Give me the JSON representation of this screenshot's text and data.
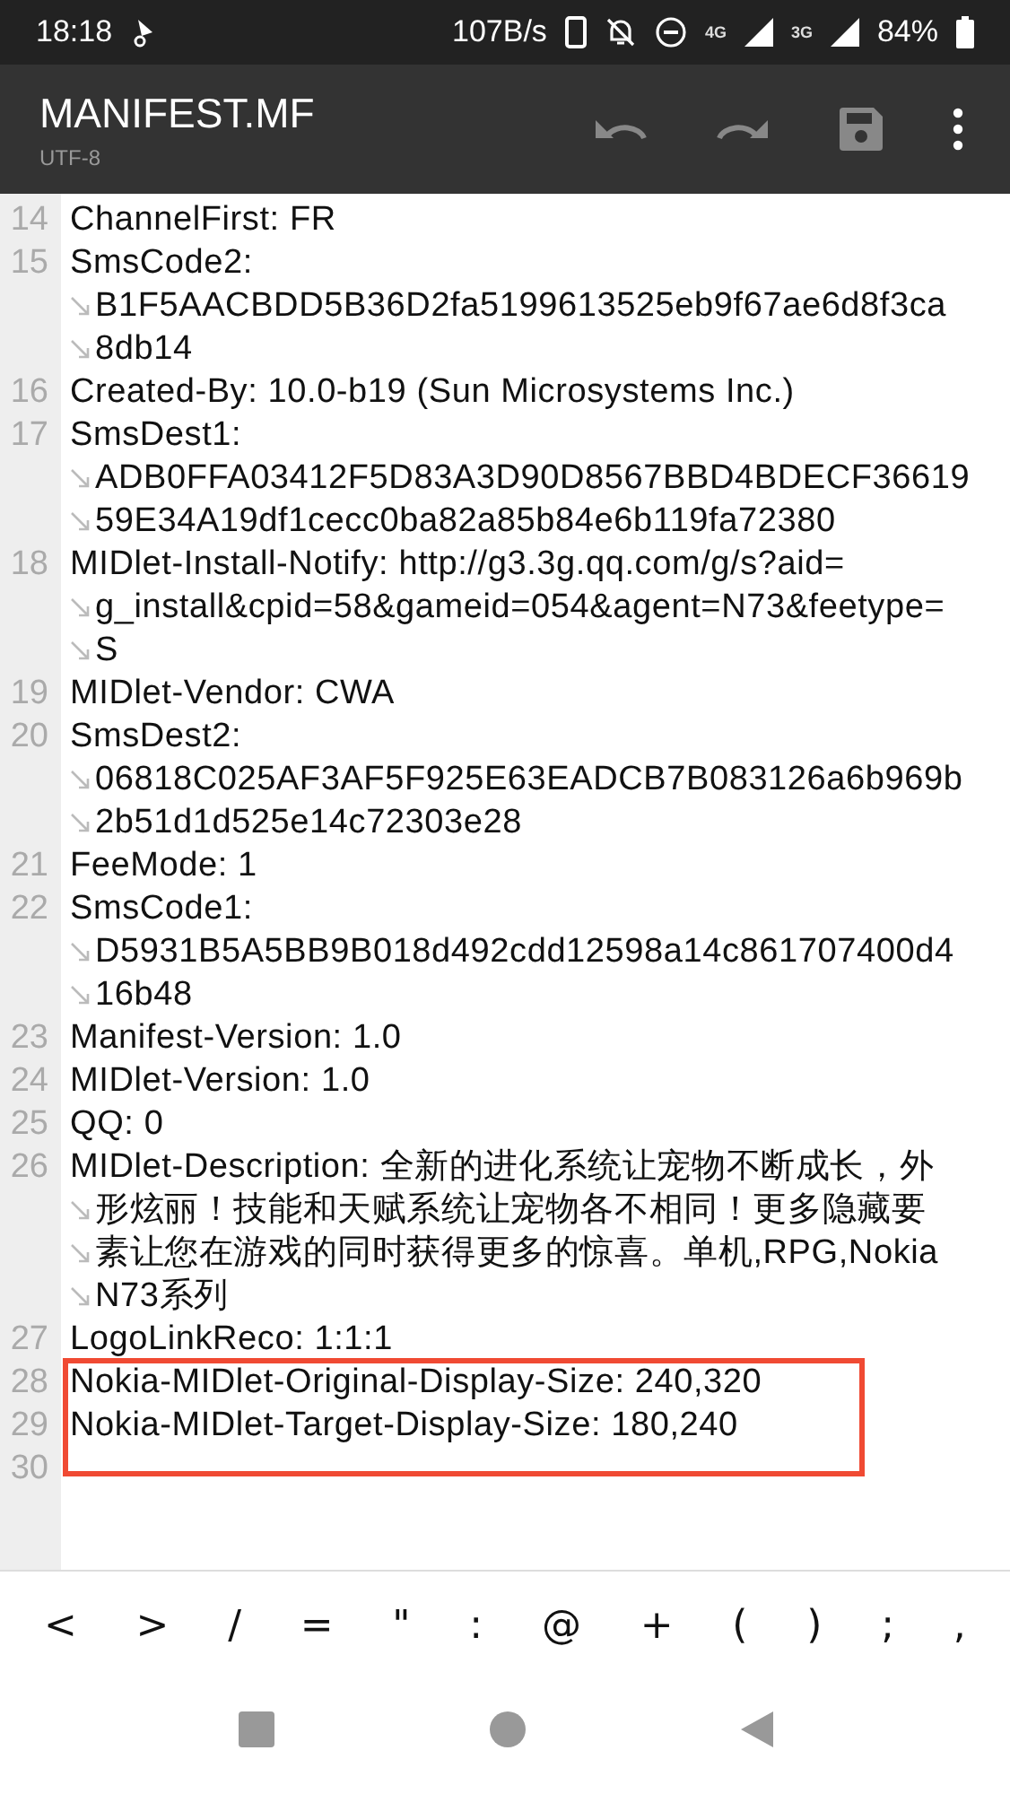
{
  "status_bar": {
    "time": "18:18",
    "speed": "107B/s",
    "network_4g": "4G",
    "network_3g": "3G",
    "battery": "84%"
  },
  "toolbar": {
    "title": "MANIFEST.MF",
    "encoding": "UTF-8"
  },
  "editor": {
    "lines": [
      {
        "number": "14",
        "rows": [
          "ChannelFirst: FR"
        ],
        "highlighted": false
      },
      {
        "number": "15",
        "rows": [
          "SmsCode2:",
          "B1F5AACBDD5B36D2fa5199613525eb9f67ae6d8f3ca",
          "8db14"
        ],
        "highlighted": false
      },
      {
        "number": "16",
        "rows": [
          "Created-By: 10.0-b19 (Sun Microsystems Inc.)"
        ],
        "highlighted": false
      },
      {
        "number": "17",
        "rows": [
          "SmsDest1:",
          "ADB0FFA03412F5D83A3D90D8567BBD4BDECF36619",
          "59E34A19df1cecc0ba82a85b84e6b119fa72380"
        ],
        "highlighted": false
      },
      {
        "number": "18",
        "rows": [
          "MIDlet-Install-Notify: http://g3.3g.qq.com/g/s?aid=",
          "g_install&cpid=58&gameid=054&agent=N73&feetype=",
          "S"
        ],
        "highlighted": false
      },
      {
        "number": "19",
        "rows": [
          "MIDlet-Vendor: CWA"
        ],
        "highlighted": false
      },
      {
        "number": "20",
        "rows": [
          "SmsDest2:",
          "06818C025AF3AF5F925E63EADCB7B083126a6b969b",
          "2b51d1d525e14c72303e28"
        ],
        "highlighted": false
      },
      {
        "number": "21",
        "rows": [
          "FeeMode: 1"
        ],
        "highlighted": false
      },
      {
        "number": "22",
        "rows": [
          "SmsCode1:",
          "D5931B5A5BB9B018d492cdd12598a14c861707400d4",
          "16b48"
        ],
        "highlighted": false
      },
      {
        "number": "23",
        "rows": [
          "Manifest-Version: 1.0"
        ],
        "highlighted": false
      },
      {
        "number": "24",
        "rows": [
          "MIDlet-Version: 1.0"
        ],
        "highlighted": false
      },
      {
        "number": "25",
        "rows": [
          "QQ: 0"
        ],
        "highlighted": false
      },
      {
        "number": "26",
        "rows": [
          "MIDlet-Description: 全新的进化系统让宠物不断成长，外",
          "形炫丽！技能和天赋系统让宠物各不相同！更多隐藏要",
          "素让您在游戏的同时获得更多的惊喜。单机,RPG,Nokia",
          "N73系列"
        ],
        "highlighted": false
      },
      {
        "number": "27",
        "rows": [
          "LogoLinkReco: 1:1:1"
        ],
        "highlighted": false
      },
      {
        "number": "28",
        "rows": [
          "Nokia-MIDlet-Original-Display-Size: 240,320"
        ],
        "highlighted": true
      },
      {
        "number": "29",
        "rows": [
          "Nokia-MIDlet-Target-Display-Size: 180,240"
        ],
        "highlighted": true
      },
      {
        "number": "30",
        "highlighted": true
      }
    ]
  },
  "symbol_bar": [
    "<",
    ">",
    "/",
    "=",
    "\"",
    ":",
    "@",
    "+",
    "(",
    ")",
    ";",
    ","
  ]
}
